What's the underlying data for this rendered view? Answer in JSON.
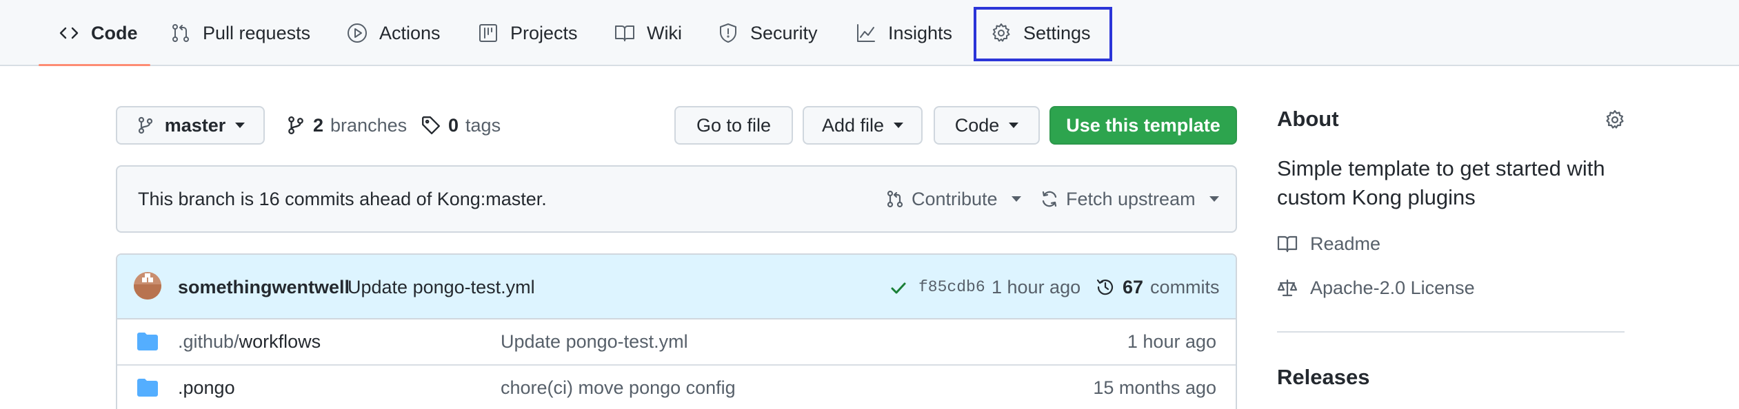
{
  "nav": {
    "tabs": [
      {
        "label": "Code",
        "icon": "code-icon",
        "selected": true
      },
      {
        "label": "Pull requests",
        "icon": "git-pull-request-icon"
      },
      {
        "label": "Actions",
        "icon": "play-icon"
      },
      {
        "label": "Projects",
        "icon": "table-icon"
      },
      {
        "label": "Wiki",
        "icon": "book-icon"
      },
      {
        "label": "Security",
        "icon": "shield-icon"
      },
      {
        "label": "Insights",
        "icon": "graph-icon"
      },
      {
        "label": "Settings",
        "icon": "gear-icon",
        "highlighted": true
      }
    ],
    "highlight_color": "#2b35d8",
    "underline_color": "#fd8c73"
  },
  "toolbar": {
    "branch": "master",
    "branches_count": "2",
    "branches_label": "branches",
    "tags_count": "0",
    "tags_label": "tags",
    "go_to_file": "Go to file",
    "add_file": "Add file",
    "code": "Code",
    "use_template": "Use this template",
    "primary_color": "#2da44e"
  },
  "ahead_banner": {
    "text": "This branch is 16 commits ahead of Kong:master.",
    "contribute": "Contribute",
    "fetch_upstream": "Fetch upstream"
  },
  "latest_commit": {
    "author": "somethingwentwell",
    "message": "Update pongo-test.yml",
    "status": "check-icon",
    "sha": "f85cdb6",
    "time": "1 hour ago",
    "commits_count": "67",
    "commits_label": "commits"
  },
  "files": [
    {
      "name_prefix": ".github/",
      "name": "workflows",
      "message": "Update pongo-test.yml",
      "time": "1 hour ago",
      "icon": "folder-icon"
    },
    {
      "name_prefix": "",
      "name": ".pongo",
      "message": "chore(ci) move pongo config",
      "time": "15 months ago",
      "icon": "folder-icon"
    }
  ],
  "sidebar": {
    "about_title": "About",
    "description": "Simple template to get started with custom Kong plugins",
    "readme": "Readme",
    "license": "Apache-2.0 License",
    "releases_title": "Releases"
  }
}
